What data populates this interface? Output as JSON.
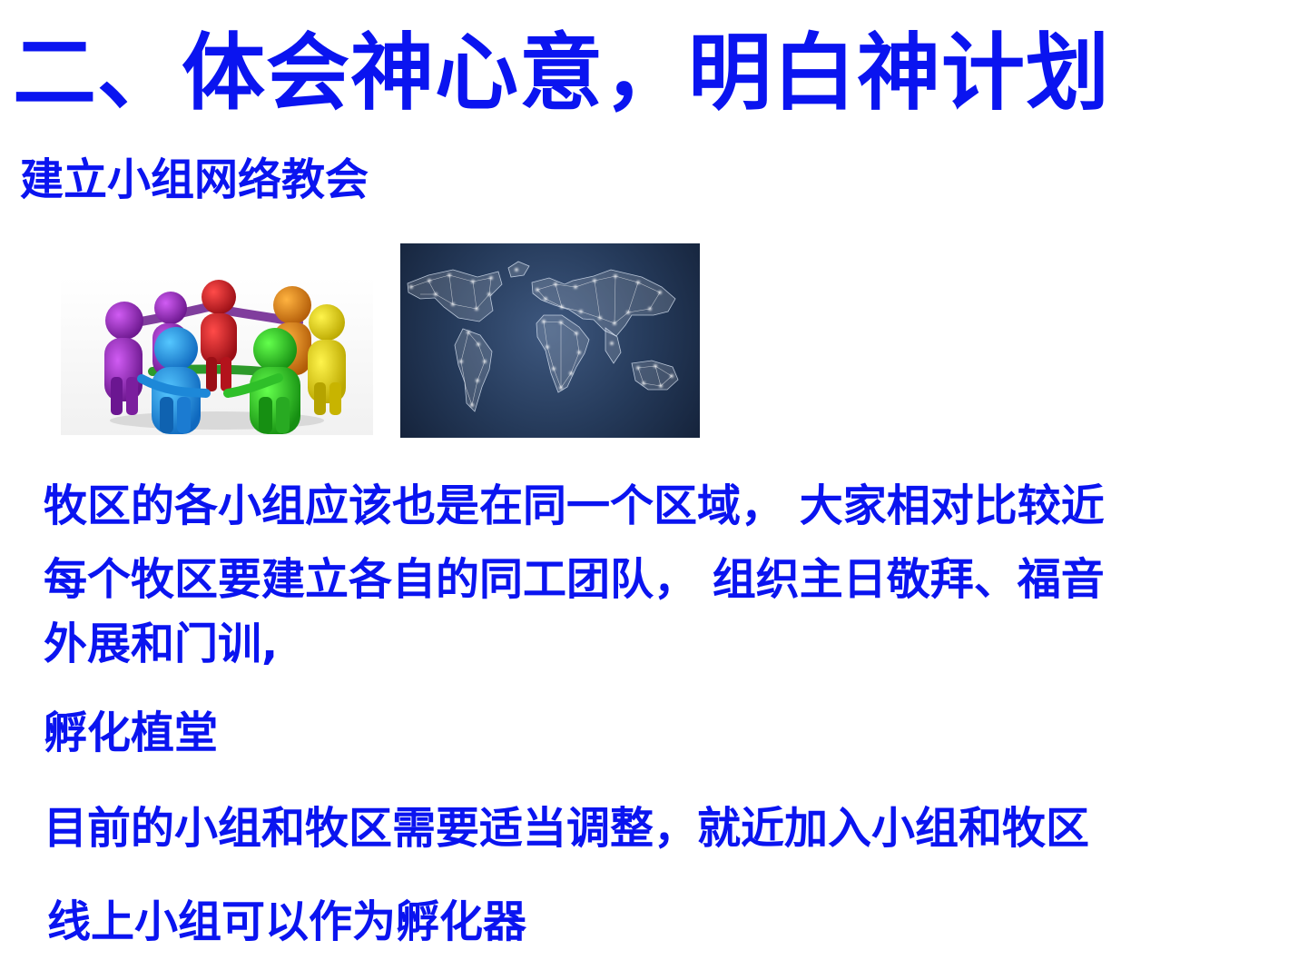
{
  "slide": {
    "title": "二、体会神心意，明白神计划",
    "subtitle": "建立小组网络教会",
    "body": [
      "牧区的各小组应该也是在同一个区域， 大家相对比较近",
      "每个牧区要建立各自的同工团队， 组织主日敬拜、福音",
      "外展和门训,",
      "孵化植堂",
      "目前的小组和牧区需要适当调整，就近加入小组和牧区",
      "线上小组可以作为孵化器"
    ]
  },
  "colors": {
    "text": "#0a14f0",
    "background": "#ffffff"
  },
  "images": {
    "people_circle": "colored-people-holding-hands-image",
    "world_network": "world-network-map-image"
  }
}
